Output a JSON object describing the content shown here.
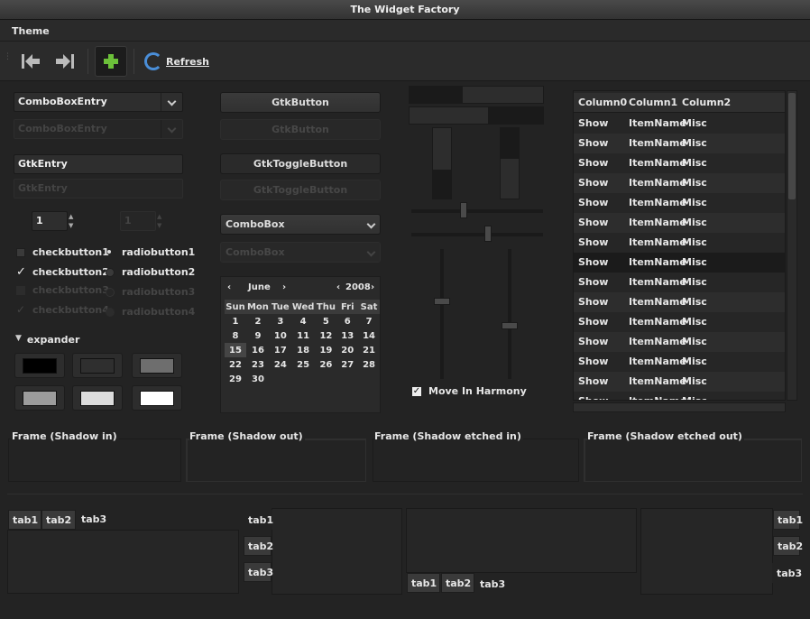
{
  "window": {
    "title": "The Widget Factory"
  },
  "menu": {
    "theme": "Theme"
  },
  "toolbar": {
    "refresh_label": "Refresh"
  },
  "col1": {
    "combo_entry": "ComboBoxEntry",
    "combo_entry_disabled": "ComboBoxEntry",
    "entry": "GtkEntry",
    "entry_disabled": "GtkEntry",
    "spin1": "1",
    "spin2": "1",
    "checkbutton1": "checkbutton1",
    "checkbutton2": "checkbutton2",
    "checkbutton3": "checkbutton3",
    "checkbutton4": "checkbutton4",
    "radiobutton1": "radiobutton1",
    "radiobutton2": "radiobutton2",
    "radiobutton3": "radiobutton3",
    "radiobutton4": "radiobutton4",
    "expander": "expander",
    "swatch_colors": [
      "#000000",
      "#2f2f2f",
      "#6e6e6e",
      "#9c9c9c",
      "#dcdcdc",
      "#ffffff"
    ]
  },
  "col2": {
    "button": "GtkButton",
    "button_disabled": "GtkButton",
    "toggle": "GtkToggleButton",
    "toggle_disabled": "GtkToggleButton",
    "combobox": "ComboBox",
    "combobox_disabled": "ComboBox"
  },
  "calendar": {
    "month": "June",
    "year": "2008",
    "days": [
      "Sun",
      "Mon",
      "Tue",
      "Wed",
      "Thu",
      "Fri",
      "Sat"
    ],
    "weeks": [
      [
        "1",
        "2",
        "3",
        "4",
        "5",
        "6",
        "7"
      ],
      [
        "8",
        "9",
        "10",
        "11",
        "12",
        "13",
        "14"
      ],
      [
        "15",
        "16",
        "17",
        "18",
        "19",
        "20",
        "21"
      ],
      [
        "22",
        "23",
        "24",
        "25",
        "26",
        "27",
        "28"
      ],
      [
        "29",
        "30",
        "",
        "",
        "",
        "",
        ""
      ]
    ],
    "selected": "15"
  },
  "col3": {
    "move_in_harmony": "Move In Harmony"
  },
  "tree": {
    "headers": [
      "Column0",
      "Column1",
      "Column2"
    ],
    "rows": [
      [
        "Show",
        "ItemName",
        "Misc"
      ],
      [
        "Show",
        "ItemName",
        "Misc"
      ],
      [
        "Show",
        "ItemName",
        "Misc"
      ],
      [
        "Show",
        "ItemName",
        "Misc"
      ],
      [
        "Show",
        "ItemName",
        "Misc"
      ],
      [
        "Show",
        "ItemName",
        "Misc"
      ],
      [
        "Show",
        "ItemName",
        "Misc"
      ],
      [
        "Show",
        "ItemName",
        "Misc"
      ],
      [
        "Show",
        "ItemName",
        "Misc"
      ],
      [
        "Show",
        "ItemName",
        "Misc"
      ],
      [
        "Show",
        "ItemName",
        "Misc"
      ],
      [
        "Show",
        "ItemName",
        "Misc"
      ],
      [
        "Show",
        "ItemName",
        "Misc"
      ],
      [
        "Show",
        "ItemName",
        "Misc"
      ],
      [
        "Show",
        "ItemName",
        "Misc"
      ]
    ],
    "highlighted_row": 7
  },
  "frames": {
    "shadow_in": "Frame (Shadow in)",
    "shadow_out": "Frame (Shadow out)",
    "etched_in": "Frame (Shadow etched in)",
    "etched_out": "Frame (Shadow etched out)"
  },
  "notebooks": {
    "tab1": "tab1",
    "tab2": "tab2",
    "tab3": "tab3"
  }
}
